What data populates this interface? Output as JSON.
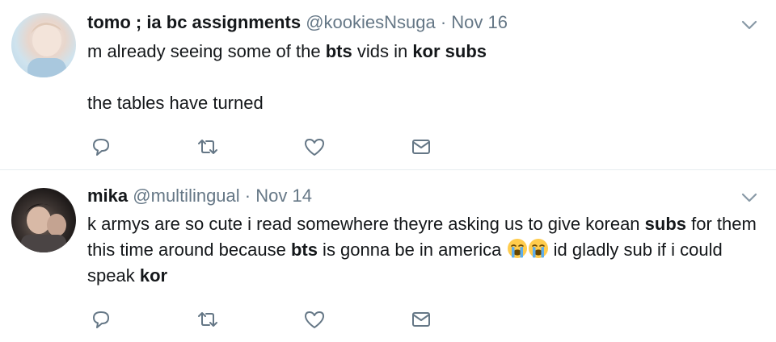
{
  "tweets": [
    {
      "name": "tomo ; ia bc assignments",
      "handle": "@kookiesNsuga",
      "separator": "·",
      "date": "Nov 16",
      "line1": [
        "m already seeing some of the ",
        "bts",
        " vids in ",
        "kor subs"
      ],
      "line2": "the tables have turned"
    },
    {
      "name": "mika",
      "handle": "@multilingual",
      "separator": "·",
      "date": "Nov 14",
      "text": [
        "k armys are so cute i read somewhere theyre asking us to give korean ",
        "subs",
        " for them this time around because ",
        "bts",
        " is gonna be in america ",
        " id gladly sub if i could speak ",
        "kor"
      ]
    }
  ],
  "icons": {
    "reply": "reply-icon",
    "retweet": "retweet-icon",
    "like": "heart-icon",
    "dm": "envelope-icon",
    "more": "chevron-down-icon",
    "emoji": "loudly-crying-face-emoji"
  },
  "colors": {
    "text": "#14171a",
    "secondary": "#657786",
    "divider": "#e6ecf0"
  }
}
